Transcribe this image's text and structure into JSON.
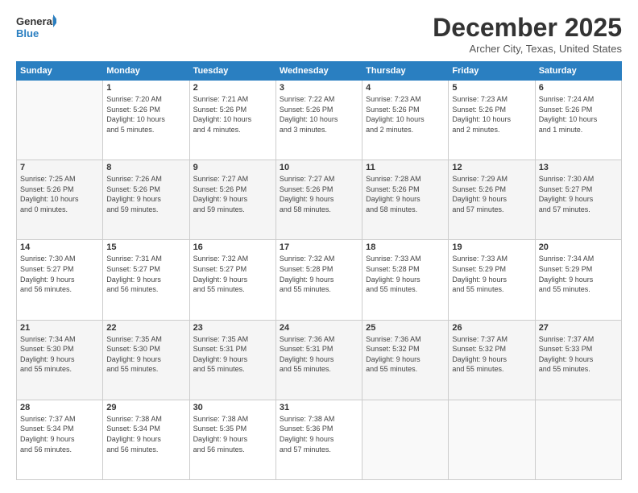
{
  "logo": {
    "line1": "General",
    "line2": "Blue"
  },
  "title": "December 2025",
  "subtitle": "Archer City, Texas, United States",
  "weekdays": [
    "Sunday",
    "Monday",
    "Tuesday",
    "Wednesday",
    "Thursday",
    "Friday",
    "Saturday"
  ],
  "weeks": [
    [
      {
        "day": "",
        "info": ""
      },
      {
        "day": "1",
        "info": "Sunrise: 7:20 AM\nSunset: 5:26 PM\nDaylight: 10 hours\nand 5 minutes."
      },
      {
        "day": "2",
        "info": "Sunrise: 7:21 AM\nSunset: 5:26 PM\nDaylight: 10 hours\nand 4 minutes."
      },
      {
        "day": "3",
        "info": "Sunrise: 7:22 AM\nSunset: 5:26 PM\nDaylight: 10 hours\nand 3 minutes."
      },
      {
        "day": "4",
        "info": "Sunrise: 7:23 AM\nSunset: 5:26 PM\nDaylight: 10 hours\nand 2 minutes."
      },
      {
        "day": "5",
        "info": "Sunrise: 7:23 AM\nSunset: 5:26 PM\nDaylight: 10 hours\nand 2 minutes."
      },
      {
        "day": "6",
        "info": "Sunrise: 7:24 AM\nSunset: 5:26 PM\nDaylight: 10 hours\nand 1 minute."
      }
    ],
    [
      {
        "day": "7",
        "info": "Sunrise: 7:25 AM\nSunset: 5:26 PM\nDaylight: 10 hours\nand 0 minutes."
      },
      {
        "day": "8",
        "info": "Sunrise: 7:26 AM\nSunset: 5:26 PM\nDaylight: 9 hours\nand 59 minutes."
      },
      {
        "day": "9",
        "info": "Sunrise: 7:27 AM\nSunset: 5:26 PM\nDaylight: 9 hours\nand 59 minutes."
      },
      {
        "day": "10",
        "info": "Sunrise: 7:27 AM\nSunset: 5:26 PM\nDaylight: 9 hours\nand 58 minutes."
      },
      {
        "day": "11",
        "info": "Sunrise: 7:28 AM\nSunset: 5:26 PM\nDaylight: 9 hours\nand 58 minutes."
      },
      {
        "day": "12",
        "info": "Sunrise: 7:29 AM\nSunset: 5:26 PM\nDaylight: 9 hours\nand 57 minutes."
      },
      {
        "day": "13",
        "info": "Sunrise: 7:30 AM\nSunset: 5:27 PM\nDaylight: 9 hours\nand 57 minutes."
      }
    ],
    [
      {
        "day": "14",
        "info": "Sunrise: 7:30 AM\nSunset: 5:27 PM\nDaylight: 9 hours\nand 56 minutes."
      },
      {
        "day": "15",
        "info": "Sunrise: 7:31 AM\nSunset: 5:27 PM\nDaylight: 9 hours\nand 56 minutes."
      },
      {
        "day": "16",
        "info": "Sunrise: 7:32 AM\nSunset: 5:27 PM\nDaylight: 9 hours\nand 55 minutes."
      },
      {
        "day": "17",
        "info": "Sunrise: 7:32 AM\nSunset: 5:28 PM\nDaylight: 9 hours\nand 55 minutes."
      },
      {
        "day": "18",
        "info": "Sunrise: 7:33 AM\nSunset: 5:28 PM\nDaylight: 9 hours\nand 55 minutes."
      },
      {
        "day": "19",
        "info": "Sunrise: 7:33 AM\nSunset: 5:29 PM\nDaylight: 9 hours\nand 55 minutes."
      },
      {
        "day": "20",
        "info": "Sunrise: 7:34 AM\nSunset: 5:29 PM\nDaylight: 9 hours\nand 55 minutes."
      }
    ],
    [
      {
        "day": "21",
        "info": "Sunrise: 7:34 AM\nSunset: 5:30 PM\nDaylight: 9 hours\nand 55 minutes."
      },
      {
        "day": "22",
        "info": "Sunrise: 7:35 AM\nSunset: 5:30 PM\nDaylight: 9 hours\nand 55 minutes."
      },
      {
        "day": "23",
        "info": "Sunrise: 7:35 AM\nSunset: 5:31 PM\nDaylight: 9 hours\nand 55 minutes."
      },
      {
        "day": "24",
        "info": "Sunrise: 7:36 AM\nSunset: 5:31 PM\nDaylight: 9 hours\nand 55 minutes."
      },
      {
        "day": "25",
        "info": "Sunrise: 7:36 AM\nSunset: 5:32 PM\nDaylight: 9 hours\nand 55 minutes."
      },
      {
        "day": "26",
        "info": "Sunrise: 7:37 AM\nSunset: 5:32 PM\nDaylight: 9 hours\nand 55 minutes."
      },
      {
        "day": "27",
        "info": "Sunrise: 7:37 AM\nSunset: 5:33 PM\nDaylight: 9 hours\nand 55 minutes."
      }
    ],
    [
      {
        "day": "28",
        "info": "Sunrise: 7:37 AM\nSunset: 5:34 PM\nDaylight: 9 hours\nand 56 minutes."
      },
      {
        "day": "29",
        "info": "Sunrise: 7:38 AM\nSunset: 5:34 PM\nDaylight: 9 hours\nand 56 minutes."
      },
      {
        "day": "30",
        "info": "Sunrise: 7:38 AM\nSunset: 5:35 PM\nDaylight: 9 hours\nand 56 minutes."
      },
      {
        "day": "31",
        "info": "Sunrise: 7:38 AM\nSunset: 5:36 PM\nDaylight: 9 hours\nand 57 minutes."
      },
      {
        "day": "",
        "info": ""
      },
      {
        "day": "",
        "info": ""
      },
      {
        "day": "",
        "info": ""
      }
    ]
  ]
}
